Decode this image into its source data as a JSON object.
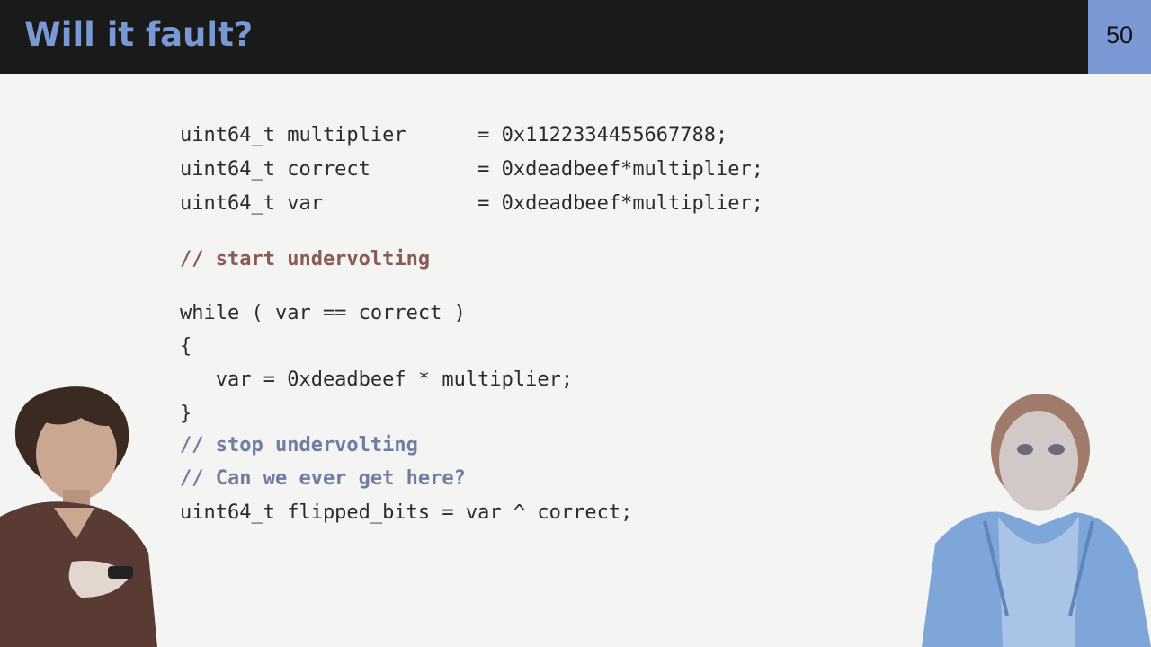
{
  "slide": {
    "title": "Will it fault?",
    "page_number": "50"
  },
  "code": {
    "line1": "uint64_t multiplier      = 0x1122334455667788;",
    "line2": "uint64_t correct         = 0xdeadbeef*multiplier;",
    "line3": "uint64_t var             = 0xdeadbeef*multiplier;",
    "comment_start": "// start undervolting",
    "line_while": "while ( var == correct )",
    "line_open": "{",
    "line_body": "   var = 0xdeadbeef * multiplier;",
    "line_close": "}",
    "comment_stop": "// stop undervolting",
    "comment_question": "// Can we ever get here?",
    "line_final": "uint64_t flipped_bits = var ^ correct;"
  },
  "colors": {
    "header_bg": "#1a1a1a",
    "title": "#7a98d3",
    "accent": "#7a98d3",
    "comment_red": "#8a5a55",
    "comment_blue": "#6f7da3"
  }
}
